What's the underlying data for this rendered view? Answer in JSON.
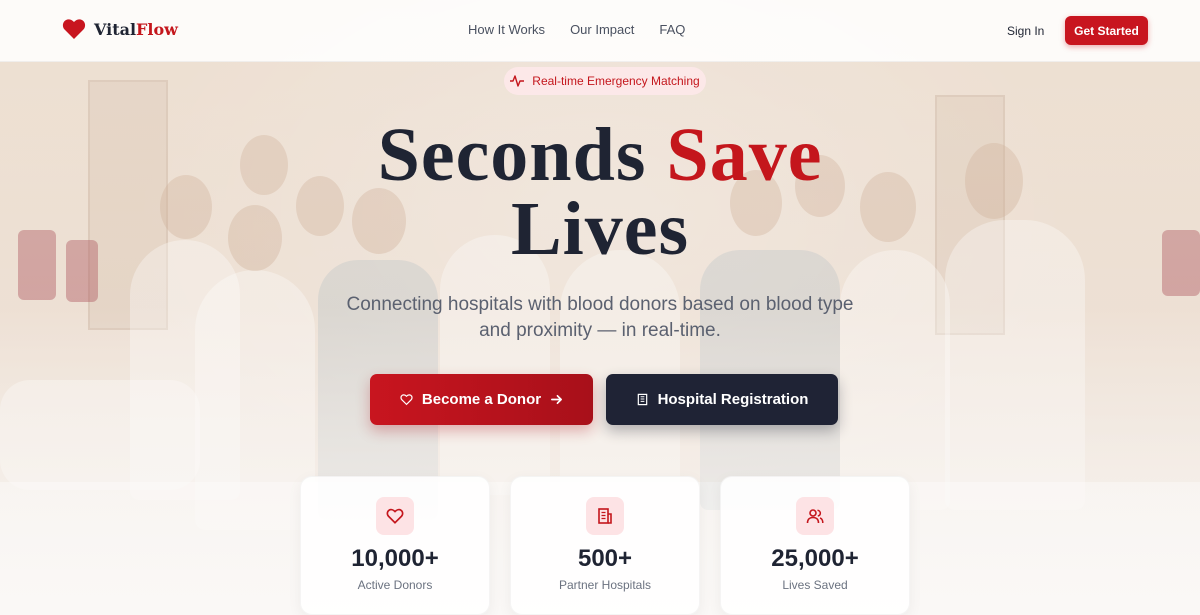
{
  "brand": {
    "name_main": "Vital",
    "name_accent": "Flow",
    "logo_icon": "heart-icon"
  },
  "nav": {
    "links": [
      "How It Works",
      "Our Impact",
      "FAQ"
    ],
    "sign_in": "Sign In",
    "get_started": "Get Started"
  },
  "hero": {
    "badge": "Real-time Emergency Matching",
    "headline_part1": "Seconds ",
    "headline_accent": "Save",
    "headline_part2": "Lives",
    "subtitle": "Connecting hospitals with blood donors based on blood type and proximity — in real-time.",
    "donor_button": "Become a Donor",
    "hospital_button": "Hospital Registration"
  },
  "stats": [
    {
      "value": "10,000+",
      "label": "Active Donors",
      "icon": "heart-icon"
    },
    {
      "value": "500+",
      "label": "Partner Hospitals",
      "icon": "hospital-icon"
    },
    {
      "value": "25,000+",
      "label": "Lives Saved",
      "icon": "users-icon"
    }
  ],
  "colors": {
    "accent": "#c4161c",
    "dark": "#1f2335",
    "badge_bg": "#fde8ea"
  }
}
